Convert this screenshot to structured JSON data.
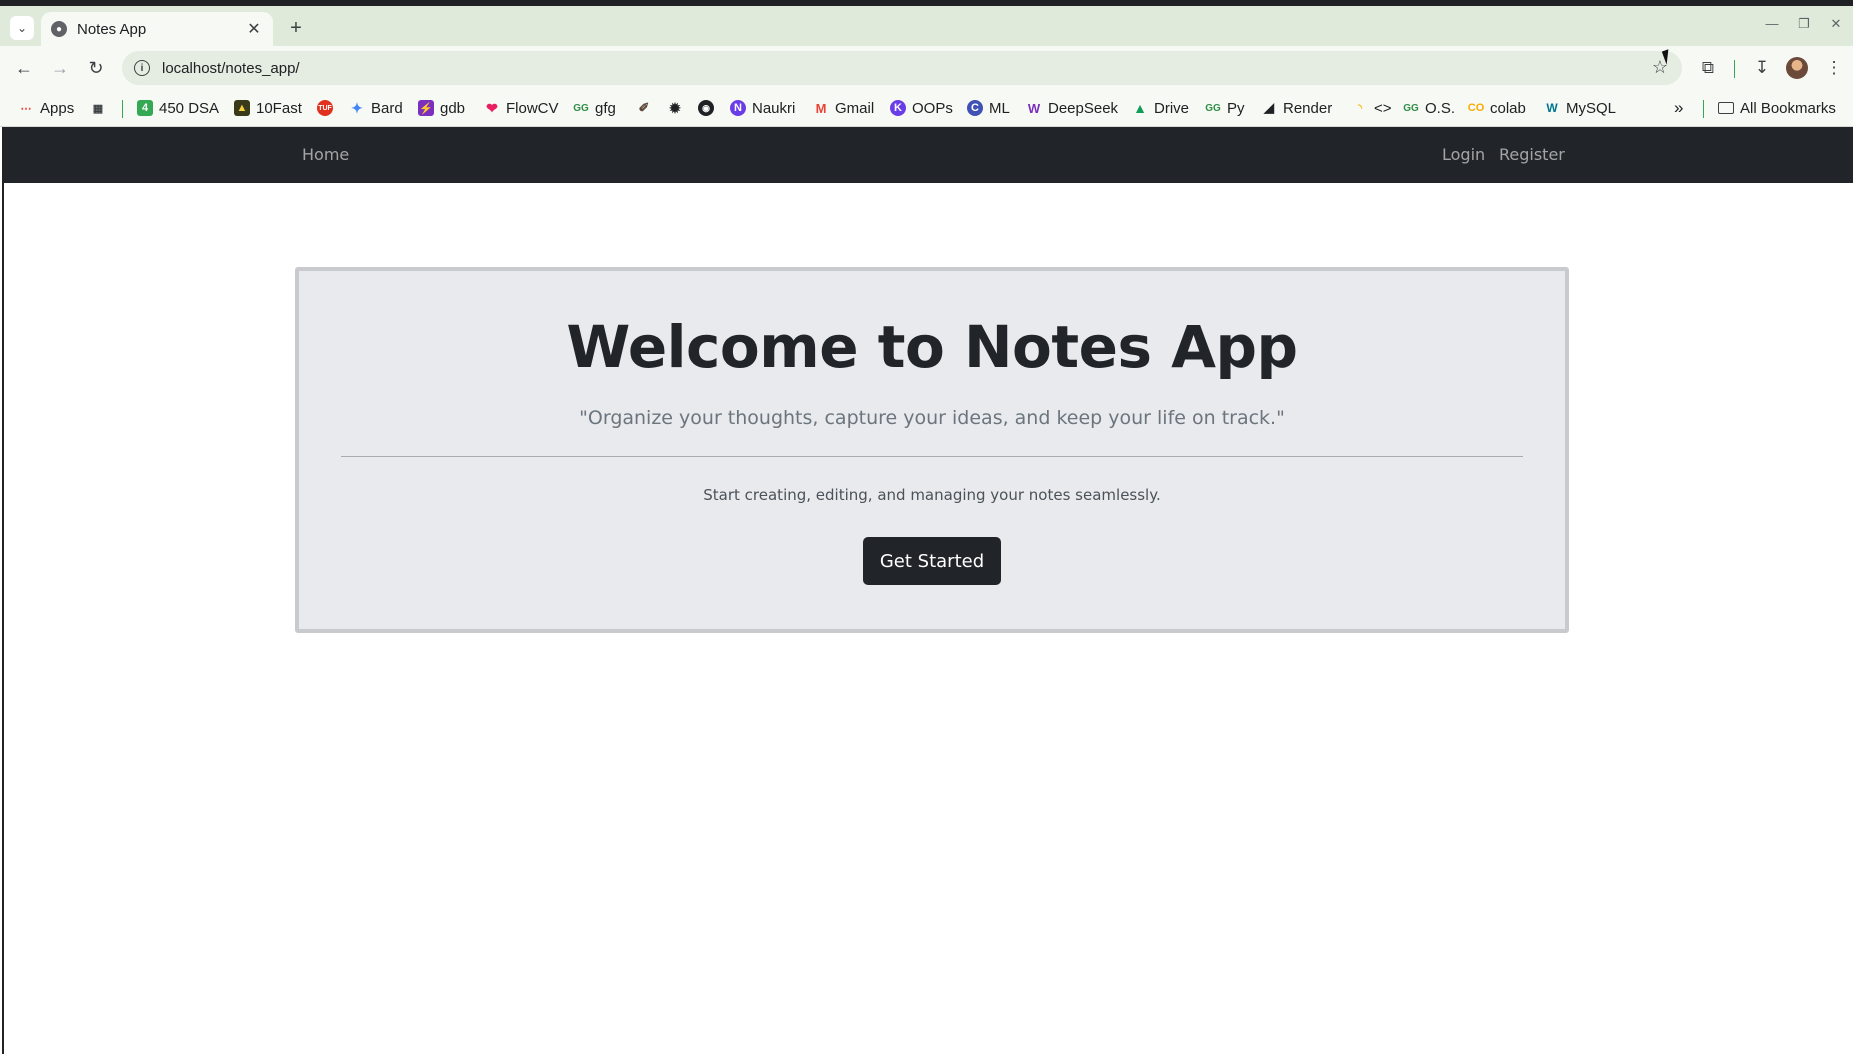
{
  "browser": {
    "tab": {
      "title": "Notes App"
    },
    "address": {
      "url": "localhost/notes_app/"
    },
    "bookmarks": [
      {
        "label": "Apps",
        "icon": "apps-grid-icon",
        "color": "#ea4335"
      },
      {
        "label": "",
        "icon": "grid-icon",
        "color": "#3c4043"
      },
      {
        "label": "450 DSA",
        "icon": "450-dsa-icon",
        "color": "#34a853"
      },
      {
        "label": "10Fast",
        "icon": "10fast-icon",
        "color": "#b8860b"
      },
      {
        "label": "",
        "icon": "tuf-icon",
        "color": "#e0301e"
      },
      {
        "label": "Bard",
        "icon": "bard-sparkle-icon",
        "color": "#4285f4"
      },
      {
        "label": "gdb",
        "icon": "gdb-icon",
        "color": "#7b2fbe"
      },
      {
        "label": "FlowCV",
        "icon": "flowcv-icon",
        "color": "#e91e63"
      },
      {
        "label": "gfg",
        "icon": "gfg-icon",
        "color": "#2f8d46"
      },
      {
        "label": "",
        "icon": "codechef-icon",
        "color": "#5b4638"
      },
      {
        "label": "",
        "icon": "openai-icon",
        "color": "#202124"
      },
      {
        "label": "",
        "icon": "github-icon",
        "color": "#202124"
      },
      {
        "label": "Naukri",
        "icon": "naukri-icon",
        "color": "#6a3de8"
      },
      {
        "label": "Gmail",
        "icon": "gmail-icon",
        "color": "#ea4335"
      },
      {
        "label": "OOPs",
        "icon": "oops-icon",
        "color": "#6a3de8"
      },
      {
        "label": "ML",
        "icon": "ml-icon",
        "color": "#3f51b5"
      },
      {
        "label": "DeepSeek",
        "icon": "deepseek-icon",
        "color": "#7b2fbe"
      },
      {
        "label": "Drive",
        "icon": "drive-icon",
        "color": "#0f9d58"
      },
      {
        "label": "Py",
        "icon": "py-gfg-icon",
        "color": "#2f8d46"
      },
      {
        "label": "Render",
        "icon": "render-icon",
        "color": "#202124"
      },
      {
        "label": "<>",
        "icon": "code-icon",
        "color": "#f4b400"
      },
      {
        "label": "O.S.",
        "icon": "os-gfg-icon",
        "color": "#2f8d46"
      },
      {
        "label": "colab",
        "icon": "colab-icon",
        "color": "#f9ab00"
      },
      {
        "label": "MySQL",
        "icon": "mysql-icon",
        "color": "#00758f"
      }
    ],
    "bookmarks_overflow": "»",
    "all_bookmarks": "All Bookmarks"
  },
  "app": {
    "navbar": {
      "home": "Home",
      "login": "Login",
      "register": "Register"
    },
    "hero": {
      "title": "Welcome to Notes App",
      "quote": "\"Organize your thoughts, capture your ideas, and keep your life on track.\"",
      "text": "Start creating, editing, and managing your notes seamlessly.",
      "button": "Get Started"
    }
  },
  "colors": {
    "navbar": "#212529",
    "hero_bg": "#e8eaee",
    "button": "#212529",
    "chrome": "#e0eadb"
  }
}
